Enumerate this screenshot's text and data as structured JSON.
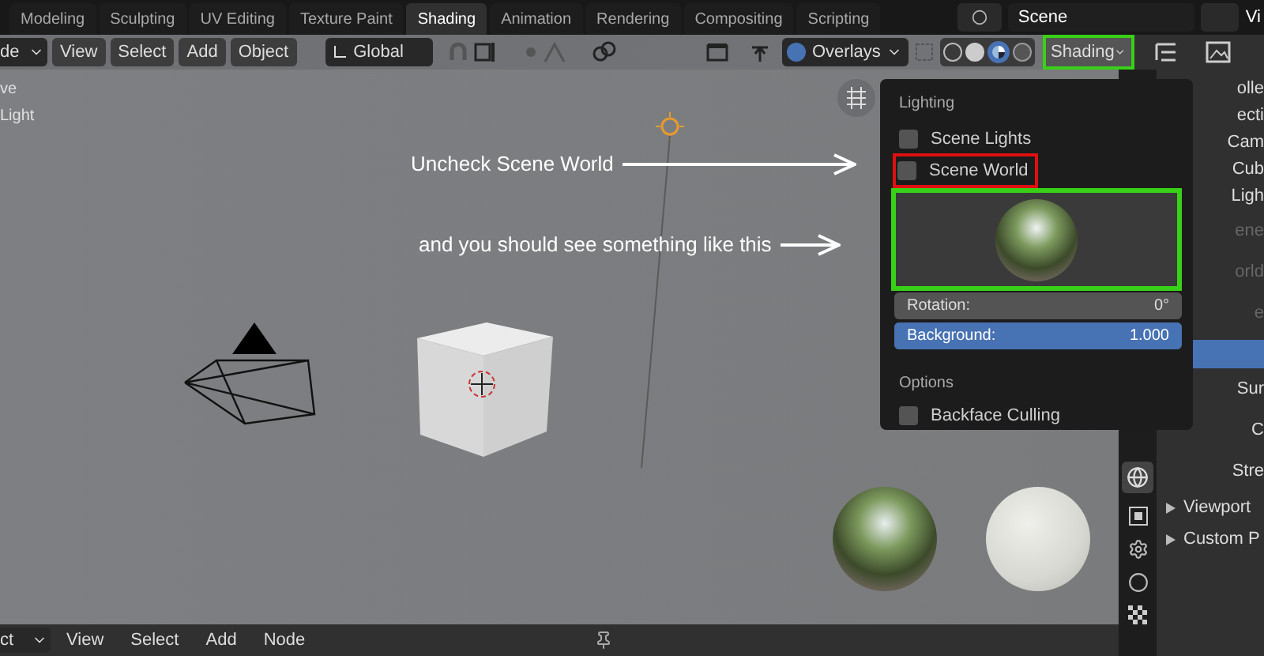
{
  "topbar": {
    "tabs": [
      {
        "label": "Modeling",
        "selected": false
      },
      {
        "label": "Sculpting",
        "selected": false
      },
      {
        "label": "UV Editing",
        "selected": false
      },
      {
        "label": "Texture Paint",
        "selected": false
      },
      {
        "label": "Shading",
        "selected": true
      },
      {
        "label": "Animation",
        "selected": false
      },
      {
        "label": "Rendering",
        "selected": false
      },
      {
        "label": "Compositing",
        "selected": false
      },
      {
        "label": "Scripting",
        "selected": false
      }
    ],
    "scene": "Scene",
    "view_layer": "Vi"
  },
  "header": {
    "mode": "de",
    "menus": [
      "View",
      "Select",
      "Add",
      "Object"
    ],
    "orientation": "Global",
    "overlays": "Overlays",
    "shading": "Shading"
  },
  "viewport": {
    "texts": [
      "ve",
      "Light"
    ]
  },
  "annotations": [
    {
      "text": "Uncheck Scene World"
    },
    {
      "text": "and you should see something like this"
    }
  ],
  "popover": {
    "lighting_heading": "Lighting",
    "lighting": [
      {
        "label": "Scene Lights",
        "checked": false
      },
      {
        "label": "Scene World",
        "checked": false
      }
    ],
    "rotation": {
      "label": "Rotation:",
      "value": "0°"
    },
    "background": {
      "label": "Background:",
      "value": "1.000",
      "level": 1
    },
    "options_heading": "Options",
    "options": [
      {
        "label": "Backface Culling",
        "checked": false
      }
    ]
  },
  "outliner": {
    "items": [
      "olle",
      "ecti",
      "Cam",
      "Cub",
      "Ligh"
    ]
  },
  "properties": {
    "texts": [
      "ene",
      "orld",
      "e"
    ],
    "fields": [
      "Sur",
      "C",
      "Stre"
    ],
    "panels": [
      "Viewport",
      "Custom P"
    ]
  },
  "bottom": {
    "mode": "ct",
    "menus": [
      "View",
      "Select",
      "Add",
      "Node"
    ]
  }
}
